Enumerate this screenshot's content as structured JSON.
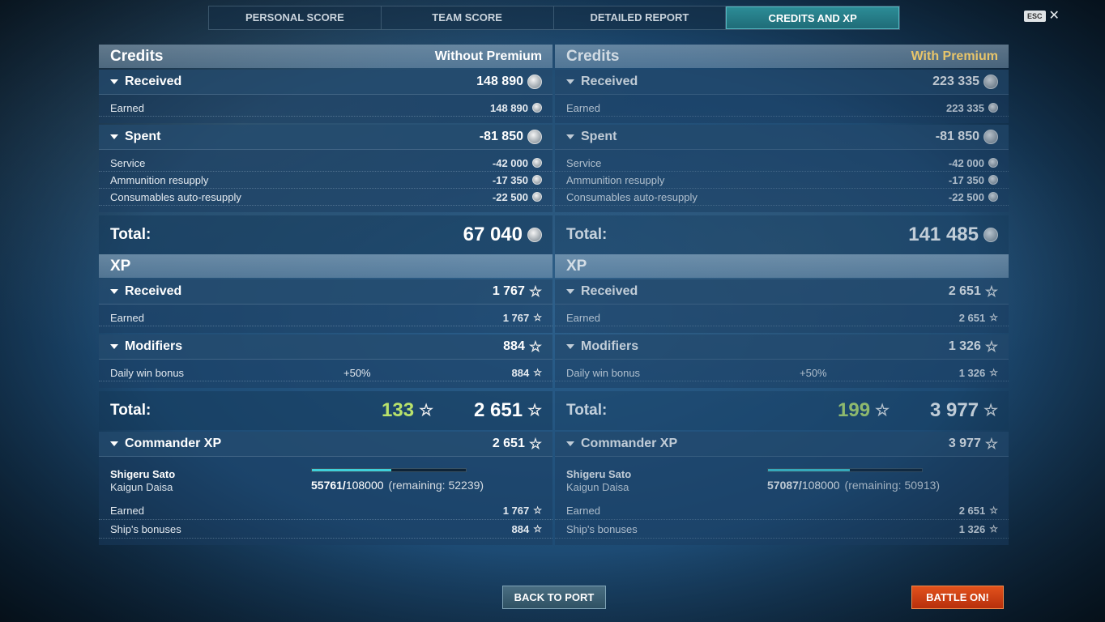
{
  "tabs": [
    {
      "label": "PERSONAL SCORE"
    },
    {
      "label": "TEAM SCORE"
    },
    {
      "label": "DETAILED REPORT"
    },
    {
      "label": "CREDITS AND XP"
    }
  ],
  "esc": {
    "key": "ESC",
    "close": "✕"
  },
  "left": {
    "credits_title": "Credits",
    "credits_sub": "Without Premium",
    "received_label": "Received",
    "received_value": "148 890",
    "earned_label": "Earned",
    "earned_value": "148 890",
    "spent_label": "Spent",
    "spent_value": "-81 850",
    "service_label": "Service",
    "service_value": "-42 000",
    "ammo_label": "Ammunition resupply",
    "ammo_value": "-17 350",
    "consum_label": "Consumables auto-resupply",
    "consum_value": "-22 500",
    "total_label": "Total:",
    "total_value": "67 040",
    "xp_title": "XP",
    "xp_received_label": "Received",
    "xp_received_value": "1 767",
    "xp_earned_label": "Earned",
    "xp_earned_value": "1 767",
    "modifiers_label": "Modifiers",
    "modifiers_value": "884",
    "daily_label": "Daily win bonus",
    "daily_pct": "+50%",
    "daily_value": "884",
    "xp_total_label": "Total:",
    "xp_bonus": "133",
    "xp_total_value": "2 651",
    "cmd_label": "Commander XP",
    "cmd_value": "2 651",
    "cmd_name": "Shigeru Sato",
    "cmd_rank": "Kaigun Daisa",
    "cmd_current": "55761/",
    "cmd_max": "108000",
    "cmd_remaining": "(remaining: 52239)",
    "cmd_progress": 0.516,
    "cmd_earned_label": "Earned",
    "cmd_earned_value": "1 767",
    "cmd_ship_label": "Ship's bonuses",
    "cmd_ship_value": "884"
  },
  "right": {
    "credits_title": "Credits",
    "credits_sub": "With Premium",
    "received_label": "Received",
    "received_value": "223 335",
    "earned_label": "Earned",
    "earned_value": "223 335",
    "spent_label": "Spent",
    "spent_value": "-81 850",
    "service_label": "Service",
    "service_value": "-42 000",
    "ammo_label": "Ammunition resupply",
    "ammo_value": "-17 350",
    "consum_label": "Consumables auto-resupply",
    "consum_value": "-22 500",
    "total_label": "Total:",
    "total_value": "141 485",
    "xp_title": "XP",
    "xp_received_label": "Received",
    "xp_received_value": "2 651",
    "xp_earned_label": "Earned",
    "xp_earned_value": "2 651",
    "modifiers_label": "Modifiers",
    "modifiers_value": "1 326",
    "daily_label": "Daily win bonus",
    "daily_pct": "+50%",
    "daily_value": "1 326",
    "xp_total_label": "Total:",
    "xp_bonus": "199",
    "xp_total_value": "3 977",
    "cmd_label": "Commander XP",
    "cmd_value": "3 977",
    "cmd_name": "Shigeru Sato",
    "cmd_rank": "Kaigun Daisa",
    "cmd_current": "57087/",
    "cmd_max": "108000",
    "cmd_remaining": "(remaining: 50913)",
    "cmd_progress": 0.529,
    "cmd_earned_label": "Earned",
    "cmd_earned_value": "2 651",
    "cmd_ship_label": "Ship's bonuses",
    "cmd_ship_value": "1 326"
  },
  "buttons": {
    "back": "BACK TO PORT",
    "battle": "BATTLE ON!"
  }
}
